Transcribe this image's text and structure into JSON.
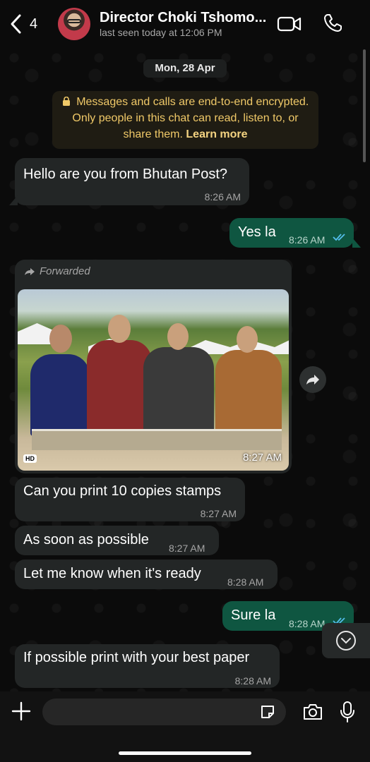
{
  "header": {
    "back_count": "4",
    "contact_name": "Director Choki Tshomo...",
    "status": "last seen today at 12:06 PM"
  },
  "chat": {
    "date": "Mon, 28 Apr",
    "encryption_notice": "Messages and calls are end-to-end encrypted. Only people in this chat can read, listen to, or share them.",
    "learn_more": "Learn more",
    "messages": [
      {
        "direction": "in",
        "text": "Hello are you from Bhutan Post?",
        "time": "8:26 AM"
      },
      {
        "direction": "out",
        "text": "Yes la",
        "time": "8:26 AM",
        "read": true
      },
      {
        "direction": "in",
        "type": "image",
        "forwarded_label": "Forwarded",
        "hd_label": "HD",
        "time": "8:27 AM"
      },
      {
        "direction": "in",
        "text": "Can you print 10 copies stamps",
        "time": "8:27 AM"
      },
      {
        "direction": "in",
        "text": "As soon as possible",
        "time": "8:27 AM"
      },
      {
        "direction": "in",
        "text": "Let me know when it's ready",
        "time": "8:28 AM"
      },
      {
        "direction": "out",
        "text": "Sure la",
        "time": "8:28 AM",
        "read": true
      },
      {
        "direction": "in",
        "text": "If possible print with your best paper",
        "time": "8:28 AM"
      }
    ]
  },
  "input": {
    "value": "",
    "placeholder": ""
  },
  "icons": {
    "back": "chevron-left-icon",
    "video_call": "video-camera-icon",
    "voice_call": "phone-icon",
    "lock": "lock-icon",
    "forward": "forward-arrow-icon",
    "share": "share-icon",
    "scroll_down": "chevron-down-circle-icon",
    "attach": "plus-icon",
    "sticker": "sticker-icon",
    "camera": "camera-icon",
    "mic": "microphone-icon"
  },
  "colors": {
    "background": "#0b0b0b",
    "incoming_bubble": "#232626",
    "outgoing_bubble": "#0f5641",
    "read_ticks": "#53bdeb",
    "notice_text": "#f0c968"
  }
}
